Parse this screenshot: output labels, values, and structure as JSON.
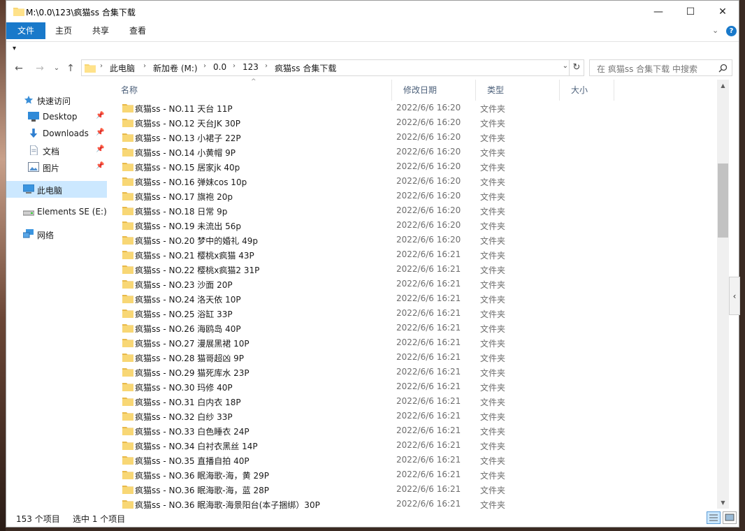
{
  "window": {
    "title": "M:\\0.0\\123\\疯猫ss 合集下载",
    "minimize": "—",
    "maximize": "☐",
    "close": "✕"
  },
  "ribbon": {
    "tabs": [
      "文件",
      "主页",
      "共享",
      "查看"
    ],
    "active_tab": "文件",
    "collapse_icon": "chevron-down-icon",
    "help_label": "?"
  },
  "qat": {
    "customize_label": "▾"
  },
  "nav": {
    "back": "←",
    "forward": "→",
    "history": "⌄",
    "up": "↑",
    "breadcrumb": [
      "此电脑",
      "新加卷 (M:)",
      "0.0",
      "123",
      "疯猫ss 合集下载"
    ],
    "dropdown": "⌄",
    "refresh": "↻",
    "search_placeholder": "在 疯猫ss 合集下载 中搜索"
  },
  "sidebar": {
    "items": [
      {
        "label": "快速访问",
        "icon": "star-icon"
      },
      {
        "label": "Desktop",
        "icon": "desktop-icon",
        "pinned": true
      },
      {
        "label": "Downloads",
        "icon": "download-icon",
        "pinned": true
      },
      {
        "label": "文档",
        "icon": "document-icon",
        "pinned": true
      },
      {
        "label": "图片",
        "icon": "picture-icon",
        "pinned": true
      },
      {
        "label": "此电脑",
        "icon": "computer-icon",
        "selected": true
      },
      {
        "label": "Elements SE (E:)",
        "icon": "drive-icon"
      },
      {
        "label": "网络",
        "icon": "network-icon"
      }
    ]
  },
  "columns": {
    "name": "名称",
    "date": "修改日期",
    "type": "类型",
    "size": "大小"
  },
  "files": [
    {
      "name": "疯猫ss - NO.11 天台 11P",
      "date": "2022/6/6 16:20",
      "type": "文件夹"
    },
    {
      "name": "疯猫ss - NO.12 天台JK 30P",
      "date": "2022/6/6 16:20",
      "type": "文件夹"
    },
    {
      "name": "疯猫ss - NO.13 小裙子 22P",
      "date": "2022/6/6 16:20",
      "type": "文件夹"
    },
    {
      "name": "疯猫ss - NO.14 小黄帽 9P",
      "date": "2022/6/6 16:20",
      "type": "文件夹"
    },
    {
      "name": "疯猫ss - NO.15 居家jk 40p",
      "date": "2022/6/6 16:20",
      "type": "文件夹"
    },
    {
      "name": "疯猫ss - NO.16 弹妹cos 10p",
      "date": "2022/6/6 16:20",
      "type": "文件夹"
    },
    {
      "name": "疯猫ss - NO.17 旗袍 20p",
      "date": "2022/6/6 16:20",
      "type": "文件夹"
    },
    {
      "name": "疯猫ss - NO.18 日常 9p",
      "date": "2022/6/6 16:20",
      "type": "文件夹"
    },
    {
      "name": "疯猫ss - NO.19 未流出 56p",
      "date": "2022/6/6 16:20",
      "type": "文件夹"
    },
    {
      "name": "疯猫ss - NO.20 梦中的婚礼 49p",
      "date": "2022/6/6 16:20",
      "type": "文件夹"
    },
    {
      "name": "疯猫ss - NO.21 樱桃x疯猫 43P",
      "date": "2022/6/6 16:21",
      "type": "文件夹"
    },
    {
      "name": "疯猫ss - NO.22 樱桃x疯猫2 31P",
      "date": "2022/6/6 16:21",
      "type": "文件夹"
    },
    {
      "name": "疯猫ss - NO.23 沙面 20P",
      "date": "2022/6/6 16:21",
      "type": "文件夹"
    },
    {
      "name": "疯猫ss - NO.24 洛天依 10P",
      "date": "2022/6/6 16:21",
      "type": "文件夹"
    },
    {
      "name": "疯猫ss - NO.25 浴缸 33P",
      "date": "2022/6/6 16:21",
      "type": "文件夹"
    },
    {
      "name": "疯猫ss - NO.26 海鸥岛 40P",
      "date": "2022/6/6 16:21",
      "type": "文件夹"
    },
    {
      "name": "疯猫ss - NO.27 漫展黑裙 10P",
      "date": "2022/6/6 16:21",
      "type": "文件夹"
    },
    {
      "name": "疯猫ss - NO.28 猫哥超凶 9P",
      "date": "2022/6/6 16:21",
      "type": "文件夹"
    },
    {
      "name": "疯猫ss - NO.29 猫死库水 23P",
      "date": "2022/6/6 16:21",
      "type": "文件夹"
    },
    {
      "name": "疯猫ss - NO.30 玛修 40P",
      "date": "2022/6/6 16:21",
      "type": "文件夹"
    },
    {
      "name": "疯猫ss - NO.31 白内衣 18P",
      "date": "2022/6/6 16:21",
      "type": "文件夹"
    },
    {
      "name": "疯猫ss - NO.32 白纱 33P",
      "date": "2022/6/6 16:21",
      "type": "文件夹"
    },
    {
      "name": "疯猫ss - NO.33 白色睡衣 24P",
      "date": "2022/6/6 16:21",
      "type": "文件夹"
    },
    {
      "name": "疯猫ss - NO.34 白衬衣黑丝 14P",
      "date": "2022/6/6 16:21",
      "type": "文件夹"
    },
    {
      "name": "疯猫ss - NO.35 直播自拍 40P",
      "date": "2022/6/6 16:21",
      "type": "文件夹"
    },
    {
      "name": "疯猫ss - NO.36 眠海歌-海，黄 29P",
      "date": "2022/6/6 16:21",
      "type": "文件夹"
    },
    {
      "name": "疯猫ss - NO.36 眠海歌-海，蓝 28P",
      "date": "2022/6/6 16:21",
      "type": "文件夹"
    },
    {
      "name": "疯猫ss - NO.36 眠海歌-海景阳台(本子捆绑）30P",
      "date": "2022/6/6 16:21",
      "type": "文件夹"
    }
  ],
  "status": {
    "item_count": "153 个项目",
    "selection": "选中 1 个项目"
  },
  "colors": {
    "accent": "#1979ca",
    "folder": "#f8d775",
    "selection": "#cce8ff"
  }
}
